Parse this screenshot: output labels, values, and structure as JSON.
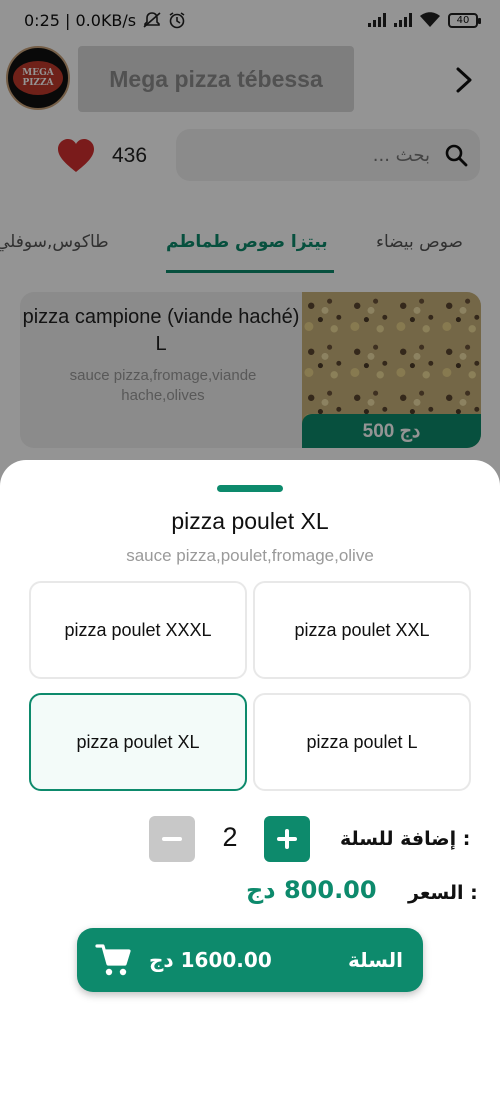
{
  "status_bar": {
    "time_speed": "0:25 | 0.0KB/s",
    "battery": "40"
  },
  "header": {
    "logo_text": "MEGA PIZZA",
    "title": "Mega pizza tébessa"
  },
  "favorites": {
    "count": "436"
  },
  "search": {
    "placeholder": "بحث ..."
  },
  "tabs": [
    {
      "label": "طاكوس,سوفلي"
    },
    {
      "label": "بيتزا صوص طماطم"
    },
    {
      "label": "صوص بيضاء"
    }
  ],
  "product_card": {
    "name": "pizza campione (viande haché) L",
    "description": "sauce pizza,fromage,viande hache,olives",
    "price": "500 دج"
  },
  "sheet": {
    "title": "pizza poulet XL",
    "description": "sauce pizza,poulet,fromage,olive",
    "options": [
      {
        "label": "pizza poulet XXXL",
        "selected": false
      },
      {
        "label": "pizza poulet XXL",
        "selected": false
      },
      {
        "label": "pizza poulet XL",
        "selected": true
      },
      {
        "label": "pizza poulet L",
        "selected": false
      }
    ],
    "quantity_label": "إضافة للسلة :",
    "quantity": "2",
    "price_label": "السعر :",
    "price_value": "800.00 دج",
    "cart_total": "1600.00 دج",
    "cart_label": "السلة"
  },
  "colors": {
    "accent": "#0d8a6c",
    "heart": "#d32f2f"
  },
  "icons": [
    "chevron-right-icon",
    "heart-icon",
    "search-icon",
    "cart-icon",
    "minus-icon",
    "plus-icon"
  ]
}
